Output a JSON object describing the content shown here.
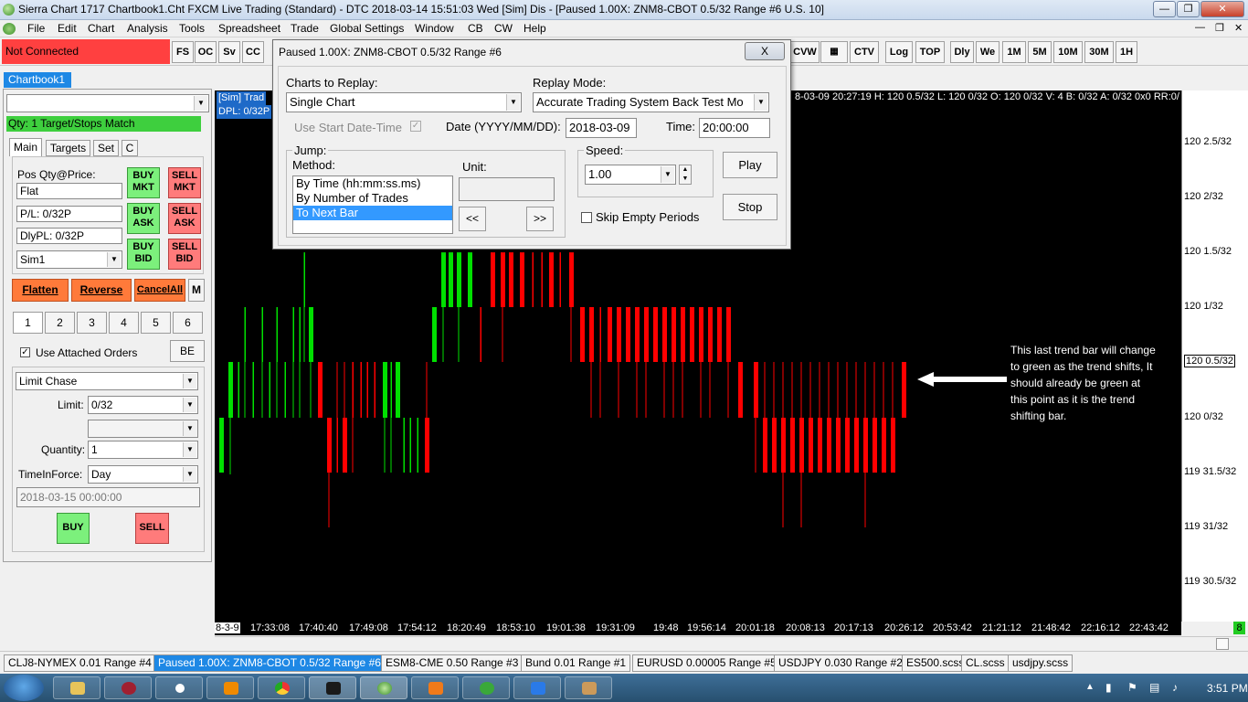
{
  "window": {
    "title": "Sierra Chart 1717 Chartbook1.Cht  FXCM Live Trading (Standard) - DTC 2018-03-14  15:51:03 Wed [Sim]  Dis - [Paused 1.00X: ZNM8-CBOT  0.5/32 Range  #6  U.S. 10]",
    "min": "—",
    "max": "❐",
    "close": "✕"
  },
  "menu": [
    "File",
    "Edit",
    "Chart",
    "Analysis",
    "Tools",
    "Spreadsheet",
    "Trade",
    "Global Settings",
    "Window",
    "CB",
    "CW",
    "Help"
  ],
  "connection": "Not Connected",
  "toolbar_left": [
    "FS",
    "OC",
    "Sv",
    "CC"
  ],
  "toolbar_right": [
    "CVW",
    "",
    "CTV",
    "Log",
    "TOP",
    "Dly",
    "We",
    "1M",
    "5M",
    "10M",
    "30M",
    "1H"
  ],
  "panel": {
    "tab": "Chartbook1",
    "status": "Qty: 1 Target/Stops Match",
    "tabs": [
      "Main",
      "Targets",
      "Set",
      "C"
    ],
    "pos_label": "Pos Qty@Price:",
    "pos": "Flat",
    "pl": "P/L: 0/32P",
    "dlypl": "DlyPL: 0/32P",
    "account": "Sim1",
    "buy_mkt": "BUY MKT",
    "sell_mkt": "SELL MKT",
    "buy_ask": "BUY ASK",
    "sell_ask": "SELL ASK",
    "buy_bid": "BUY BID",
    "sell_bid": "SELL BID",
    "flatten": "Flatten",
    "reverse": "Reverse",
    "cancel": "CancelAll",
    "m": "M",
    "nums": [
      "1",
      "2",
      "3",
      "4",
      "5",
      "6"
    ],
    "attached": "Use Attached Orders",
    "be": "BE",
    "order_type": "Limit Chase",
    "limit_label": "Limit:",
    "limit": "0/32",
    "qty_label": "Quantity:",
    "qty": "1",
    "tif_label": "TimeInForce:",
    "tif": "Day",
    "datetime": "2018-03-15  00:00:00",
    "buy": "BUY",
    "sell": "SELL"
  },
  "dialog": {
    "title": "Paused 1.00X: ZNM8-CBOT  0.5/32 Range  #6",
    "close": "X",
    "charts_label": "Charts to Replay:",
    "charts": "Single Chart",
    "mode_label": "Replay Mode:",
    "mode": "Accurate Trading System Back Test Mo",
    "use_start": "Use Start Date-Time",
    "date_label": "Date (YYYY/MM/DD):",
    "date": "2018-03-09",
    "time_label": "Time:",
    "time": "20:00:00",
    "jump_label": "Jump:",
    "method_label": "Method:",
    "unit_label": "Unit:",
    "methods": [
      "By Time (hh:mm:ss.ms)",
      "By Number of Trades",
      "To Next Bar"
    ],
    "speed_label": "Speed:",
    "speed": "1.00",
    "play": "Play",
    "stop": "Stop",
    "skip": "Skip Empty Periods",
    "prev": "<<",
    "next": ">>"
  },
  "chart": {
    "sim": "[Sim]  Trad",
    "dpl": "DPL: 0/32P",
    "header": "8-03-09 20:27:19 H: 120 0.5/32 L: 120 0/32 O: 120 0/32 V: 4 B: 0/32 A: 0/32 0x0 RR:0/",
    "annotation": "This last trend bar will change to green as the trend shifts, It should already be green at this point as it is the trend shifting bar.",
    "price_labels": [
      "120 2.5/32",
      "120 2/32",
      "120 1.5/32",
      "120 1/32",
      "120 0.5/32",
      "120 0/32",
      "119 31.5/32",
      "119 31/32",
      "119 30.5/32"
    ],
    "time_labels": [
      "8-3-9",
      "17:33:08",
      "17:40:40",
      "17:49:08",
      "17:54:12",
      "18:20:49",
      "18:53:10",
      "19:01:38",
      "19:31:09",
      "19:48",
      "19:56:14",
      "20:01:18",
      "20:08:13",
      "20:17:13",
      "20:26:12",
      "20:53:42",
      "21:21:12",
      "21:48:42",
      "22:16:12",
      "22:43:42"
    ],
    "corner": "8"
  },
  "sheets": [
    "CLJ8-NYMEX  0.01 Range  #4",
    "Paused 1.00X: ZNM8-CBOT  0.5/32 Range  #6",
    "ESM8-CME  0.50 Range  #3",
    "Bund  0.01 Range  #1",
    "EURUSD  0.00005 Range  #5",
    "USDJPY  0.030 Range  #2",
    "ES500.scss",
    "CL.scss",
    "usdjpy.scss"
  ],
  "clock": "3:51 PM",
  "colors": {
    "up": "#00e000",
    "down": "#ff0000",
    "bg": "#000000"
  }
}
